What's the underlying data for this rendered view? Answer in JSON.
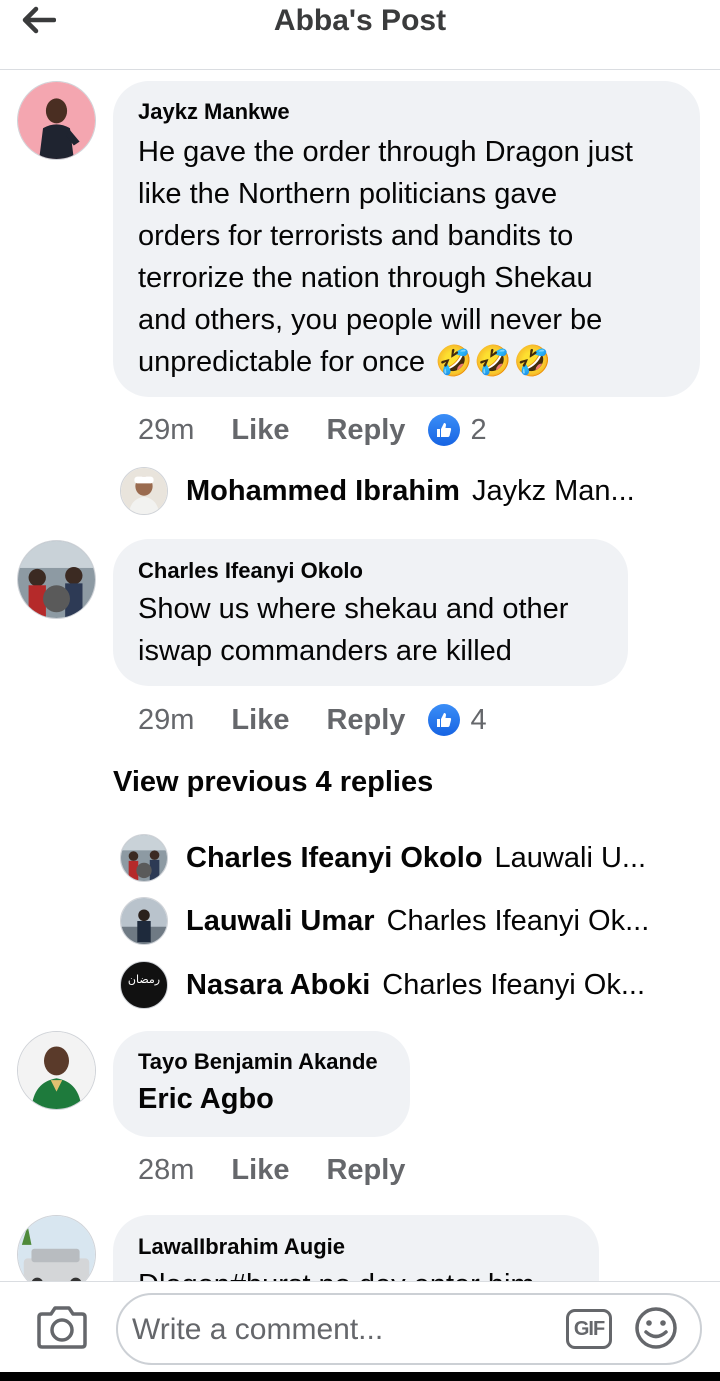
{
  "header": {
    "title": "Abba's Post",
    "back_icon": "arrow-left-icon"
  },
  "comments": [
    {
      "author": "Jaykz Mankwe",
      "lines": [
        "He gave the order through Dragon just",
        "like the Northern politicians gave",
        "orders for terrorists and bandits to",
        "terrorize the nation through Shekau",
        "and others, you people will never be",
        "unpredictable for once"
      ],
      "emoji": [
        "🤣",
        "🤣",
        "🤣"
      ],
      "time": "29m",
      "like": "Like",
      "reply": "Reply",
      "likes": "2"
    },
    {
      "author": "Charles Ifeanyi Okolo",
      "lines": [
        "Show us where shekau and other",
        "iswap commanders are killed"
      ],
      "time": "29m",
      "like": "Like",
      "reply": "Reply",
      "likes": "4"
    },
    {
      "author": "Tayo Benjamin Akande",
      "mention": "Eric Agbo",
      "time": "28m",
      "like": "Like",
      "reply": "Reply"
    },
    {
      "author": "LawalIbrahim Augie",
      "lines": [
        "Dlogon#burst no dey enter him"
      ]
    }
  ],
  "replies_first": [
    {
      "name": "Mohammed Ibrahim",
      "text": "Jaykz Man..."
    }
  ],
  "view_previous": "View previous 4 replies",
  "replies_second": [
    {
      "name": "Charles Ifeanyi Okolo",
      "text": "Lauwali U..."
    },
    {
      "name": "Lauwali Umar",
      "text": "Charles Ifeanyi Ok..."
    },
    {
      "name": "Nasara Aboki",
      "text": "Charles Ifeanyi Ok..."
    }
  ],
  "nasara_avatar_text": "رمضان",
  "composer": {
    "placeholder": "Write a comment...",
    "gif_label": "GIF"
  },
  "colors": {
    "bubble": "#f0f2f5",
    "like_blue": "#1877f2",
    "meta_gray": "#65676b"
  }
}
